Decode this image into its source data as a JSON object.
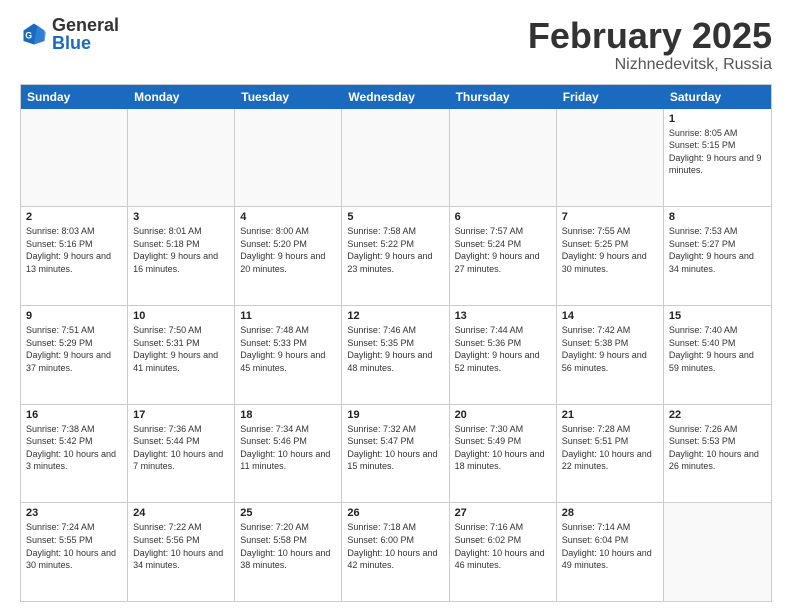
{
  "header": {
    "logo": {
      "general": "General",
      "blue": "Blue"
    },
    "title": "February 2025",
    "location": "Nizhnedevitsk, Russia"
  },
  "weekdays": [
    "Sunday",
    "Monday",
    "Tuesday",
    "Wednesday",
    "Thursday",
    "Friday",
    "Saturday"
  ],
  "rows": [
    [
      {
        "day": null
      },
      {
        "day": null
      },
      {
        "day": null
      },
      {
        "day": null
      },
      {
        "day": null
      },
      {
        "day": null
      },
      {
        "day": "1",
        "info": "Sunrise: 8:05 AM\nSunset: 5:15 PM\nDaylight: 9 hours and 9 minutes."
      }
    ],
    [
      {
        "day": "2",
        "info": "Sunrise: 8:03 AM\nSunset: 5:16 PM\nDaylight: 9 hours and 13 minutes."
      },
      {
        "day": "3",
        "info": "Sunrise: 8:01 AM\nSunset: 5:18 PM\nDaylight: 9 hours and 16 minutes."
      },
      {
        "day": "4",
        "info": "Sunrise: 8:00 AM\nSunset: 5:20 PM\nDaylight: 9 hours and 20 minutes."
      },
      {
        "day": "5",
        "info": "Sunrise: 7:58 AM\nSunset: 5:22 PM\nDaylight: 9 hours and 23 minutes."
      },
      {
        "day": "6",
        "info": "Sunrise: 7:57 AM\nSunset: 5:24 PM\nDaylight: 9 hours and 27 minutes."
      },
      {
        "day": "7",
        "info": "Sunrise: 7:55 AM\nSunset: 5:25 PM\nDaylight: 9 hours and 30 minutes."
      },
      {
        "day": "8",
        "info": "Sunrise: 7:53 AM\nSunset: 5:27 PM\nDaylight: 9 hours and 34 minutes."
      }
    ],
    [
      {
        "day": "9",
        "info": "Sunrise: 7:51 AM\nSunset: 5:29 PM\nDaylight: 9 hours and 37 minutes."
      },
      {
        "day": "10",
        "info": "Sunrise: 7:50 AM\nSunset: 5:31 PM\nDaylight: 9 hours and 41 minutes."
      },
      {
        "day": "11",
        "info": "Sunrise: 7:48 AM\nSunset: 5:33 PM\nDaylight: 9 hours and 45 minutes."
      },
      {
        "day": "12",
        "info": "Sunrise: 7:46 AM\nSunset: 5:35 PM\nDaylight: 9 hours and 48 minutes."
      },
      {
        "day": "13",
        "info": "Sunrise: 7:44 AM\nSunset: 5:36 PM\nDaylight: 9 hours and 52 minutes."
      },
      {
        "day": "14",
        "info": "Sunrise: 7:42 AM\nSunset: 5:38 PM\nDaylight: 9 hours and 56 minutes."
      },
      {
        "day": "15",
        "info": "Sunrise: 7:40 AM\nSunset: 5:40 PM\nDaylight: 9 hours and 59 minutes."
      }
    ],
    [
      {
        "day": "16",
        "info": "Sunrise: 7:38 AM\nSunset: 5:42 PM\nDaylight: 10 hours and 3 minutes."
      },
      {
        "day": "17",
        "info": "Sunrise: 7:36 AM\nSunset: 5:44 PM\nDaylight: 10 hours and 7 minutes."
      },
      {
        "day": "18",
        "info": "Sunrise: 7:34 AM\nSunset: 5:46 PM\nDaylight: 10 hours and 11 minutes."
      },
      {
        "day": "19",
        "info": "Sunrise: 7:32 AM\nSunset: 5:47 PM\nDaylight: 10 hours and 15 minutes."
      },
      {
        "day": "20",
        "info": "Sunrise: 7:30 AM\nSunset: 5:49 PM\nDaylight: 10 hours and 18 minutes."
      },
      {
        "day": "21",
        "info": "Sunrise: 7:28 AM\nSunset: 5:51 PM\nDaylight: 10 hours and 22 minutes."
      },
      {
        "day": "22",
        "info": "Sunrise: 7:26 AM\nSunset: 5:53 PM\nDaylight: 10 hours and 26 minutes."
      }
    ],
    [
      {
        "day": "23",
        "info": "Sunrise: 7:24 AM\nSunset: 5:55 PM\nDaylight: 10 hours and 30 minutes."
      },
      {
        "day": "24",
        "info": "Sunrise: 7:22 AM\nSunset: 5:56 PM\nDaylight: 10 hours and 34 minutes."
      },
      {
        "day": "25",
        "info": "Sunrise: 7:20 AM\nSunset: 5:58 PM\nDaylight: 10 hours and 38 minutes."
      },
      {
        "day": "26",
        "info": "Sunrise: 7:18 AM\nSunset: 6:00 PM\nDaylight: 10 hours and 42 minutes."
      },
      {
        "day": "27",
        "info": "Sunrise: 7:16 AM\nSunset: 6:02 PM\nDaylight: 10 hours and 46 minutes."
      },
      {
        "day": "28",
        "info": "Sunrise: 7:14 AM\nSunset: 6:04 PM\nDaylight: 10 hours and 49 minutes."
      },
      {
        "day": null
      }
    ]
  ]
}
